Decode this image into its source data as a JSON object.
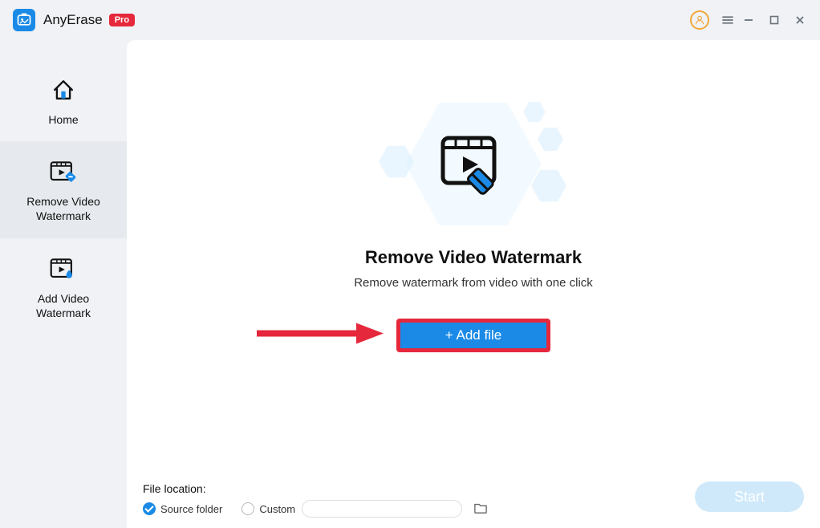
{
  "app": {
    "title": "AnyErase",
    "badge": "Pro"
  },
  "sidebar": {
    "items": [
      {
        "label": "Home"
      },
      {
        "label": "Remove Video\nWatermark"
      },
      {
        "label": "Add Video\nWatermark"
      }
    ]
  },
  "main": {
    "title": "Remove Video Watermark",
    "subtitle": "Remove watermark from video with one click",
    "add_file_label": "+ Add file"
  },
  "file_location": {
    "label": "File location:",
    "source": "Source folder",
    "custom": "Custom",
    "selected": "source"
  },
  "start_label": "Start"
}
